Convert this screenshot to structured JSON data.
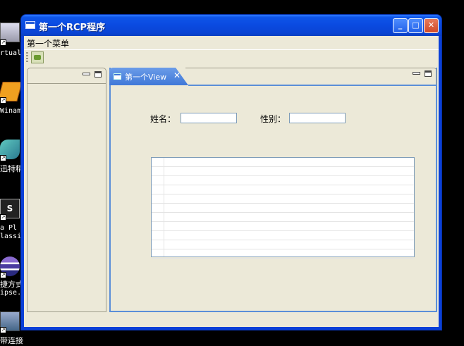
{
  "desktop": {
    "icons": [
      {
        "name": "virtual-pc-icon",
        "caption": "rtual"
      },
      {
        "name": "winamp-icon",
        "caption": "Winam"
      },
      {
        "name": "app-icon",
        "caption": "迅特精"
      },
      {
        "name": "flash-player-icon",
        "caption1": "a Pl",
        "caption2": "lassi"
      },
      {
        "name": "eclipse-icon",
        "caption1": "捷方式",
        "caption2": "ipse."
      },
      {
        "name": "network-icon",
        "caption": "带连接"
      }
    ]
  },
  "window": {
    "title": "第一个RCP程序",
    "controls": {
      "minimize": "_",
      "maximize": "□",
      "close": "✕"
    }
  },
  "menubar": {
    "items": [
      {
        "label": "第一个菜单"
      }
    ]
  },
  "main_view": {
    "tab_label": "第一个View",
    "tab_close": "✕",
    "form": {
      "name_label": "姓名：",
      "name_value": "",
      "gender_label": "性别：",
      "gender_value": ""
    }
  },
  "colors": {
    "accent": "#5a8ed8",
    "titlebar": "#0a4ae0",
    "background": "#ece9d8"
  }
}
